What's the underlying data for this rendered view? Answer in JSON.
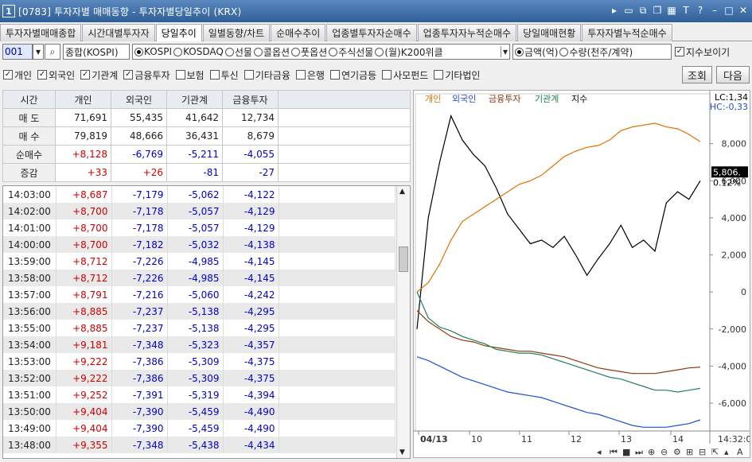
{
  "window": {
    "number": "1",
    "title": "[0783] 투자자별 매매동향 - 투자자별당일추이 (KRX)"
  },
  "tabs": [
    "투자자별매매종합",
    "시간대별투자자",
    "당일추이",
    "일별동향/차트",
    "순매수추이",
    "업종별투자자순매수",
    "업종투자자누적순매수",
    "당일매매현황",
    "투자자별누적순매수"
  ],
  "controls": {
    "code": "001",
    "market_name": "종합(KOSPI)",
    "markets": [
      "KOSPI",
      "KOSDAQ",
      "선물",
      "콜옵션",
      "풋옵션",
      "주식선물",
      "(월)K200위클"
    ],
    "units": [
      "금액(억)",
      "수량(천주/계약)"
    ],
    "show_index": "지수보이기"
  },
  "investors": [
    {
      "label": "개인",
      "checked": true
    },
    {
      "label": "외국인",
      "checked": true
    },
    {
      "label": "기관계",
      "checked": true
    },
    {
      "label": "금융투자",
      "checked": true
    },
    {
      "label": "보험",
      "checked": false
    },
    {
      "label": "투신",
      "checked": false
    },
    {
      "label": "기타금융",
      "checked": false
    },
    {
      "label": "은행",
      "checked": false
    },
    {
      "label": "연기금등",
      "checked": false
    },
    {
      "label": "사모펀드",
      "checked": false
    },
    {
      "label": "기타법인",
      "checked": false
    }
  ],
  "buttons": {
    "query": "조회",
    "next": "다음"
  },
  "summary": {
    "headers": [
      "시간",
      "개인",
      "외국인",
      "기관계",
      "금융투자"
    ],
    "rows": [
      {
        "label": "매 도",
        "values": [
          "71,691",
          "55,435",
          "41,642",
          "12,734"
        ]
      },
      {
        "label": "매 수",
        "values": [
          "79,819",
          "48,666",
          "36,431",
          "8,679"
        ]
      },
      {
        "label": "순매수",
        "values": [
          "+8,128",
          "-6,769",
          "-5,211",
          "-4,055"
        ]
      },
      {
        "label": "증감",
        "values": [
          "+33",
          "+26",
          "-81",
          "-27"
        ]
      }
    ]
  },
  "timeline": [
    [
      "14:03:00",
      "+8,687",
      "-7,179",
      "-5,062",
      "-4,122"
    ],
    [
      "14:02:00",
      "+8,700",
      "-7,178",
      "-5,057",
      "-4,129"
    ],
    [
      "14:01:00",
      "+8,700",
      "-7,178",
      "-5,057",
      "-4,129"
    ],
    [
      "14:00:00",
      "+8,700",
      "-7,182",
      "-5,032",
      "-4,138"
    ],
    [
      "13:59:00",
      "+8,712",
      "-7,226",
      "-4,985",
      "-4,145"
    ],
    [
      "13:58:00",
      "+8,712",
      "-7,226",
      "-4,985",
      "-4,145"
    ],
    [
      "13:57:00",
      "+8,791",
      "-7,216",
      "-5,060",
      "-4,242"
    ],
    [
      "13:56:00",
      "+8,885",
      "-7,237",
      "-5,138",
      "-4,295"
    ],
    [
      "13:55:00",
      "+8,885",
      "-7,237",
      "-5,138",
      "-4,295"
    ],
    [
      "13:54:00",
      "+9,181",
      "-7,348",
      "-5,323",
      "-4,357"
    ],
    [
      "13:53:00",
      "+9,222",
      "-7,386",
      "-5,309",
      "-4,375"
    ],
    [
      "13:52:00",
      "+9,222",
      "-7,386",
      "-5,309",
      "-4,375"
    ],
    [
      "13:51:00",
      "+9,252",
      "-7,391",
      "-5,319",
      "-4,394"
    ],
    [
      "13:50:00",
      "+9,404",
      "-7,390",
      "-5,459",
      "-4,490"
    ],
    [
      "13:49:00",
      "+9,404",
      "-7,390",
      "-5,459",
      "-4,490"
    ],
    [
      "13:48:00",
      "+9,355",
      "-7,348",
      "-5,438",
      "-4,434"
    ]
  ],
  "chart_data": {
    "type": "line",
    "legend": [
      "개인",
      "외국인",
      "금융투자",
      "기관계",
      "지수"
    ],
    "colors": {
      "개인": "#e07000",
      "외국인": "#2050d0",
      "금융투자": "#8b3a10",
      "기관계": "#208050",
      "지수": "#000000"
    },
    "y_ticks": [
      "8,000",
      "6,000",
      "4,000",
      "2,000",
      "0",
      "-2,000",
      "-4,000",
      "-6,000"
    ],
    "ylim": [
      -7500,
      10000
    ],
    "x_ticks": [
      "04/13",
      "10",
      "11",
      "12",
      "13",
      "14"
    ],
    "right_labels": {
      "lc": "LC:1,34",
      "hc": "HC:-0,33",
      "price": "5,806.",
      "pct": "0.12%"
    },
    "time_label": "14:32:0",
    "series": {
      "개인": [
        0,
        500,
        1500,
        2800,
        3800,
        4200,
        4600,
        5000,
        5400,
        5800,
        6000,
        6300,
        6800,
        7300,
        7600,
        7800,
        7900,
        8200,
        8700,
        8900,
        9000,
        9100,
        8900,
        8800,
        8500,
        8100
      ],
      "외국인": [
        -3500,
        -3700,
        -4000,
        -4300,
        -4600,
        -4800,
        -5000,
        -5200,
        -5400,
        -5500,
        -5600,
        -5700,
        -5900,
        -6100,
        -6300,
        -6500,
        -6600,
        -6800,
        -7000,
        -7200,
        -7300,
        -7300,
        -7300,
        -7200,
        -7100,
        -6900
      ],
      "금융투자": [
        -1000,
        -1600,
        -2000,
        -2400,
        -2600,
        -2700,
        -2900,
        -3000,
        -3100,
        -3200,
        -3200,
        -3300,
        -3400,
        -3500,
        -3700,
        -3900,
        -4100,
        -4200,
        -4300,
        -4400,
        -4400,
        -4400,
        -4300,
        -4200,
        -4100,
        -4050
      ],
      "기관계": [
        0,
        -1400,
        -1900,
        -2100,
        -2400,
        -2600,
        -2800,
        -3100,
        -3200,
        -3300,
        -3300,
        -3400,
        -3600,
        -3800,
        -4000,
        -4200,
        -4400,
        -4600,
        -4700,
        -4900,
        -5100,
        -5300,
        -5300,
        -5400,
        -5300,
        -5200
      ],
      "지수": [
        -2000,
        4000,
        7000,
        9500,
        8200,
        7400,
        6800,
        5600,
        4200,
        3400,
        2600,
        2800,
        2400,
        3000,
        2000,
        900,
        1800,
        2600,
        3600,
        2400,
        2800,
        2200,
        4800,
        5400,
        5000,
        6000
      ]
    }
  }
}
